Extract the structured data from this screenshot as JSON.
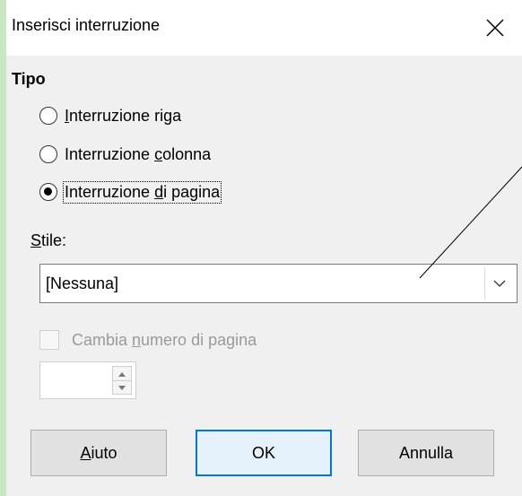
{
  "window": {
    "title": "Inserisci interruzione"
  },
  "tipo": {
    "title": "Tipo",
    "options": [
      {
        "before": "",
        "underline": "I",
        "after": "nterruzione riga",
        "checked": false
      },
      {
        "before": "Interruzione ",
        "underline": "c",
        "after": "olonna",
        "checked": false
      },
      {
        "before": "Interruzione ",
        "underline": "d",
        "after": "i pagina",
        "checked": true
      }
    ]
  },
  "stile": {
    "label_underline": "S",
    "label_rest": "tile:",
    "value": "[Nessuna]"
  },
  "page_number": {
    "label_before": "Cambia ",
    "label_underline": "n",
    "label_after": "umero di pagina",
    "checked": false,
    "enabled": false,
    "value": ""
  },
  "buttons": {
    "help_underline": "A",
    "help_rest": "iuto",
    "ok": "OK",
    "cancel": "Annulla"
  }
}
